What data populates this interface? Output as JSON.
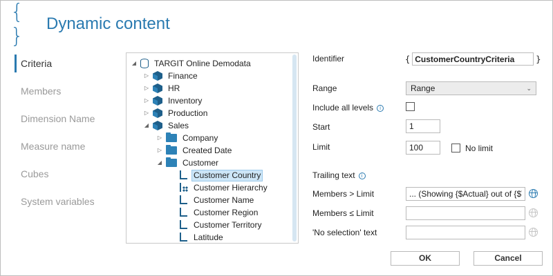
{
  "dialog": {
    "title": "Dynamic content",
    "icon": "curly-braces-icon"
  },
  "nav": {
    "items": [
      {
        "label": "Criteria",
        "active": true
      },
      {
        "label": "Members",
        "active": false
      },
      {
        "label": "Dimension Name",
        "active": false
      },
      {
        "label": "Measure name",
        "active": false
      },
      {
        "label": "Cubes",
        "active": false
      },
      {
        "label": "System variables",
        "active": false
      }
    ]
  },
  "tree": {
    "root": "TARGIT Online Demodata",
    "cubes": [
      "Finance",
      "HR",
      "Inventory",
      "Production",
      "Sales"
    ],
    "sales_children": [
      "Company",
      "Created Date",
      "Customer"
    ],
    "customer_levels": [
      "Customer Country",
      "Customer Hierarchy",
      "Customer Name",
      "Customer Region",
      "Customer Territory",
      "Latitude"
    ],
    "selected": "Customer Country"
  },
  "form": {
    "identifier_label": "Identifier",
    "identifier_open": "{",
    "identifier_value": "CustomerCountryCriteria",
    "identifier_close": "}",
    "range_label": "Range",
    "range_value": "Range",
    "include_all_label": "Include all levels",
    "include_all_checked": false,
    "start_label": "Start",
    "start_value": "1",
    "limit_label": "Limit",
    "limit_value": "100",
    "no_limit_label": "No limit",
    "no_limit_checked": false,
    "trailing_label": "Trailing text",
    "members_gt_label": "Members > Limit",
    "members_gt_value": "... (Showing {$Actual} out of {$To",
    "members_le_label": "Members ≤ Limit",
    "members_le_value": "",
    "no_selection_label": "'No selection' text",
    "no_selection_value": ""
  },
  "buttons": {
    "ok": "OK",
    "cancel": "Cancel"
  },
  "colors": {
    "accent": "#2a7ab0",
    "cube": "#1e5f8a",
    "selection": "#cde6f7"
  }
}
